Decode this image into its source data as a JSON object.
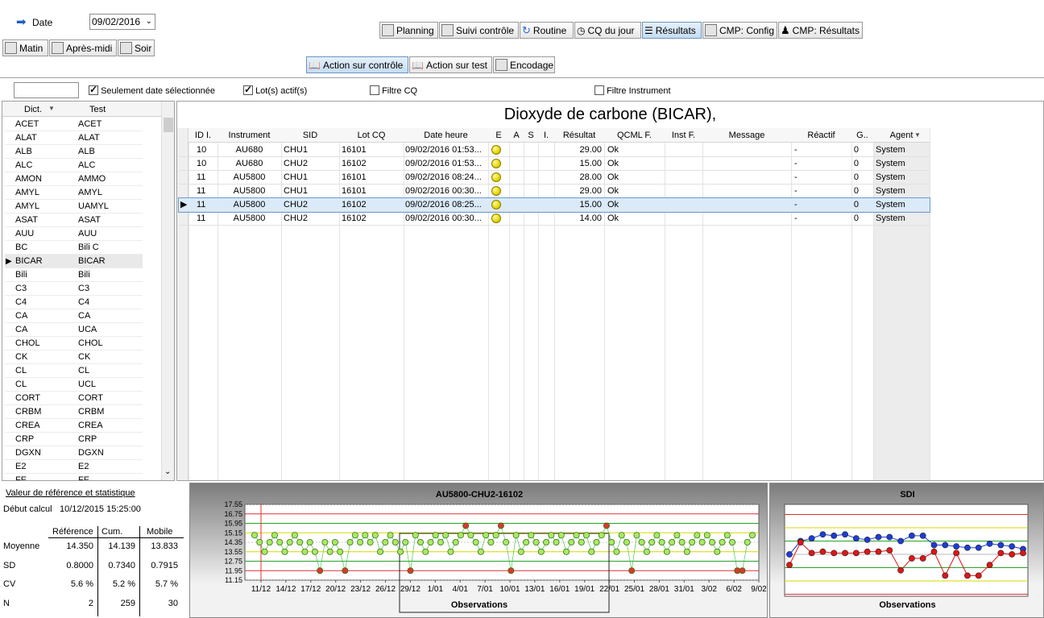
{
  "top": {
    "date_label": "Date",
    "date_value": "09/02/2016",
    "shift_buttons": [
      "Matin",
      "Après-midi",
      "Soir"
    ],
    "nav_tabs": [
      "Planning",
      "Suivi contrôle",
      "Routine",
      "CQ du jour",
      "Résultats",
      "CMP: Config",
      "CMP: Résultats"
    ],
    "action_tabs": [
      "Action sur contrôle",
      "Action sur test",
      "Encodage"
    ]
  },
  "filters": {
    "search_value": "",
    "only_selected_date": "Seulement date sélectionnée",
    "active_lots": "Lot(s) actif(s)",
    "cq_filter": "Filtre CQ",
    "instrument_filter": "Filtre Instrument"
  },
  "dict": {
    "headers": [
      "Dict.",
      "Test"
    ],
    "rows": [
      [
        "ACET",
        "ACET"
      ],
      [
        "ALAT",
        "ALAT"
      ],
      [
        "ALB",
        "ALB"
      ],
      [
        "ALC",
        "ALC"
      ],
      [
        "AMON",
        "AMMO"
      ],
      [
        "AMYL",
        "AMYL"
      ],
      [
        "AMYL",
        "UAMYL"
      ],
      [
        "ASAT",
        "ASAT"
      ],
      [
        "AUU",
        "AUU"
      ],
      [
        "BC",
        "Bili C"
      ],
      [
        "BICAR",
        "BICAR"
      ],
      [
        "Bili",
        "Bili"
      ],
      [
        "C3",
        "C3"
      ],
      [
        "C4",
        "C4"
      ],
      [
        "CA",
        "CA"
      ],
      [
        "CA",
        "UCA"
      ],
      [
        "CHOL",
        "CHOL"
      ],
      [
        "CK",
        "CK"
      ],
      [
        "CL",
        "CL"
      ],
      [
        "CL",
        "UCL"
      ],
      [
        "CORT",
        "CORT"
      ],
      [
        "CRBM",
        "CRBM"
      ],
      [
        "CREA",
        "CREA"
      ],
      [
        "CRP",
        "CRP"
      ],
      [
        "DGXN",
        "DGXN"
      ],
      [
        "E2",
        "E2"
      ],
      [
        "FE",
        "FE"
      ]
    ],
    "selected_index": 10
  },
  "main": {
    "title": "Dioxyde de carbone (BICAR),",
    "columns": [
      "ID I.",
      "Instrument",
      "SID",
      "Lot CQ",
      "Date heure",
      "E",
      "A",
      "S",
      "I.",
      "Résultat",
      "QCML F.",
      "Inst F.",
      "Message",
      "Réactif",
      "G..",
      "Agent"
    ],
    "rows": [
      [
        "10",
        "AU680",
        "CHU1",
        "16101",
        "09/02/2016 01:53...",
        "29.00",
        "Ok",
        "-",
        "0",
        "System"
      ],
      [
        "10",
        "AU680",
        "CHU2",
        "16102",
        "09/02/2016 01:53...",
        "15.00",
        "Ok",
        "-",
        "0",
        "System"
      ],
      [
        "11",
        "AU5800",
        "CHU1",
        "16101",
        "09/02/2016 08:24...",
        "28.00",
        "Ok",
        "-",
        "0",
        "System"
      ],
      [
        "11",
        "AU5800",
        "CHU1",
        "16101",
        "09/02/2016 00:30...",
        "29.00",
        "Ok",
        "-",
        "0",
        "System"
      ],
      [
        "11",
        "AU5800",
        "CHU2",
        "16102",
        "09/02/2016 08:25...",
        "15.00",
        "Ok",
        "-",
        "0",
        "System"
      ],
      [
        "11",
        "AU5800",
        "CHU2",
        "16102",
        "09/02/2016 00:30...",
        "14.00",
        "Ok",
        "-",
        "0",
        "System"
      ]
    ],
    "selected_row": 4
  },
  "stats": {
    "title": "Valeur de référence et statistique",
    "debut_label": "Début calcul",
    "debut_value": "10/12/2015 15:25:00",
    "col_headers": [
      "Référence",
      "Cum.",
      "Mobile"
    ],
    "rows": [
      {
        "label": "Moyenne",
        "values": [
          "14.350",
          "14.139",
          "13.833"
        ]
      },
      {
        "label": "SD",
        "values": [
          "0.8000",
          "0.7340",
          "0.7915"
        ]
      },
      {
        "label": "CV",
        "values": [
          "5.6 %",
          "5.2 %",
          "5.7 %"
        ]
      },
      {
        "label": "N",
        "values": [
          "2",
          "259",
          "30"
        ]
      }
    ]
  },
  "chart_data": [
    {
      "type": "scatter",
      "title": "AU5800-CHU2-16102",
      "xlabel": "Observations",
      "ylabel": "",
      "y_ticks": [
        "17.55",
        "16.75",
        "15.95",
        "15.15",
        "14.35",
        "13.55",
        "12.75",
        "11.95",
        "11.15"
      ],
      "ylim": [
        11.15,
        17.55
      ],
      "x_ticks": [
        "11/12",
        "14/12",
        "17/12",
        "20/12",
        "23/12",
        "26/12",
        "29/12",
        "1/01",
        "4/01",
        "7/01",
        "10/01",
        "13/01",
        "16/01",
        "19/01",
        "22/01",
        "25/01",
        "28/01",
        "31/01",
        "3/02",
        "6/02",
        "9/02"
      ],
      "reference_lines": [
        {
          "value": 16.75,
          "color": "#e03030"
        },
        {
          "value": 15.95,
          "color": "#2aa02a"
        },
        {
          "value": 15.15,
          "color": "#d8d800"
        },
        {
          "value": 13.55,
          "color": "#d8d800"
        },
        {
          "value": 12.75,
          "color": "#2aa02a"
        },
        {
          "value": 11.95,
          "color": "#e03030"
        }
      ],
      "series": [
        {
          "values": [
            14.95,
            14.35,
            13.55,
            14.35,
            14.95,
            14.35,
            13.55,
            14.35,
            14.95,
            14.35,
            13.55,
            14.35,
            13.55,
            11.95,
            14.35,
            13.55,
            14.35,
            13.55,
            11.95,
            14.35,
            14.95,
            14.35,
            14.95,
            14.35,
            14.95,
            13.55,
            14.35,
            14.95,
            14.35,
            13.55,
            14.35,
            11.95,
            14.95,
            14.35,
            13.55,
            14.35,
            14.95,
            14.35,
            14.95,
            13.55,
            14.35,
            14.95,
            15.75,
            14.95,
            14.35,
            13.55,
            14.95,
            14.35,
            14.95,
            15.75,
            14.35,
            11.95,
            14.95,
            13.55,
            14.35,
            14.95,
            14.35,
            13.55,
            14.35,
            14.95,
            14.35,
            14.95,
            13.55,
            14.35,
            14.95,
            14.35,
            14.95,
            13.55,
            14.35,
            14.95,
            15.75,
            14.35,
            13.55,
            14.95,
            14.35,
            11.95,
            14.95,
            14.35,
            13.55,
            14.35,
            14.95,
            14.35,
            13.55,
            14.35,
            14.95,
            14.35,
            13.55,
            14.35,
            14.95,
            14.35,
            14.95,
            14.35,
            13.55,
            14.35,
            14.95,
            14.35,
            11.95,
            11.95,
            14.35,
            14.95
          ]
        }
      ]
    },
    {
      "type": "scatter",
      "title": "SDI",
      "xlabel": "Observations",
      "series": [
        {
          "name": "blue",
          "color": "#1e3cd6",
          "values": [
            0.0,
            1.0,
            1.2,
            1.5,
            1.4,
            1.5,
            1.2,
            1.1,
            1.3,
            1.3,
            1.0,
            1.4,
            1.4,
            0.7,
            0.7,
            0.6,
            0.5,
            0.5,
            0.8,
            0.7,
            0.6,
            0.4
          ]
        },
        {
          "name": "red",
          "color": "#e01515",
          "values": [
            -0.8,
            0.9,
            0.1,
            0.2,
            0.1,
            0.1,
            0.1,
            0.2,
            0.2,
            0.3,
            -1.2,
            -0.3,
            -0.3,
            0.2,
            -1.6,
            0.1,
            -1.6,
            -1.6,
            -0.8,
            0.1,
            0.0,
            0.1
          ]
        }
      ]
    }
  ]
}
